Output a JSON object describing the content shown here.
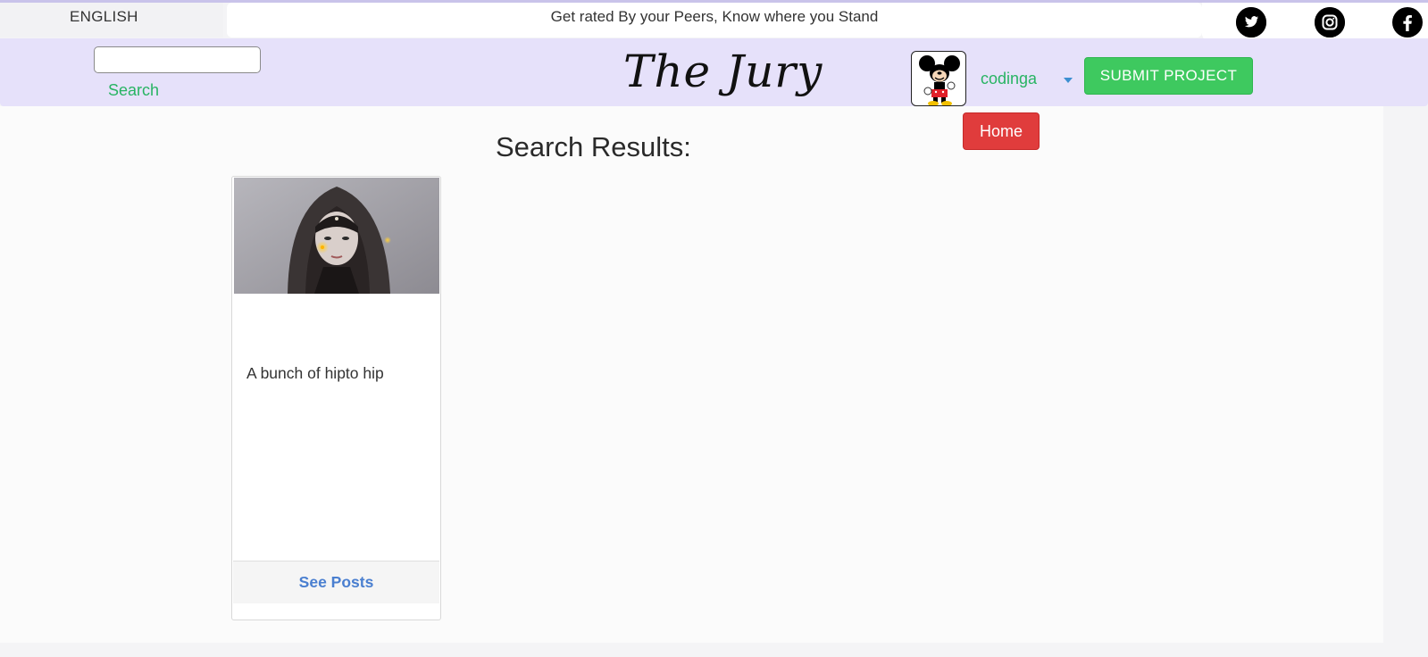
{
  "topbar": {
    "language": "ENGLISH",
    "tagline": "Get rated By your Peers, Know where you Stand",
    "social": [
      {
        "icon": "twitter-icon"
      },
      {
        "icon": "instagram-icon"
      },
      {
        "icon": "facebook-icon"
      }
    ]
  },
  "navbar": {
    "search_placeholder": "",
    "search_value": "",
    "search_label": "Search",
    "brand": "The Jury",
    "avatar_icon": "mickey-avatar",
    "username": "codinga",
    "submit_label": "SUBMIT PROJECT",
    "home_label": "Home"
  },
  "main": {
    "heading": "Search Results:",
    "results": [
      {
        "image": "hooded-figure-image",
        "description": "A bunch of hipto hip",
        "action_label": "See Posts"
      }
    ]
  },
  "colors": {
    "navbar_bg": "#e6e1fa",
    "accent_green": "#3ec95f",
    "link_green": "#28b463",
    "home_red": "#e03c3c",
    "link_blue": "#4a7fd0"
  }
}
